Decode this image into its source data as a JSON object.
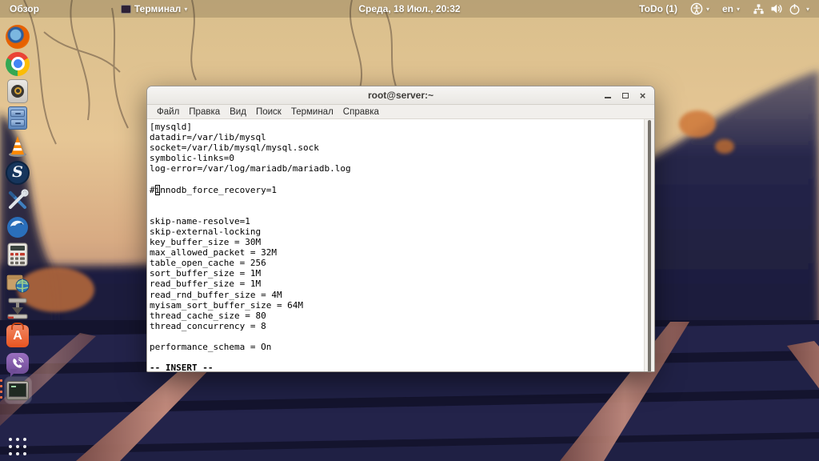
{
  "colors": {
    "accent_orange": "#e95420",
    "topbar_bg_tint": "rgba(62,50,30,0.20)",
    "terminal_bg": "#ffffff",
    "terminal_fg": "#000000",
    "rail_rust": "#c98f7f",
    "forest_navy": "#1d1d3a"
  },
  "top_bar": {
    "activities": "Обзор",
    "app_menu_label": "Терминал",
    "caret_glyph": "▾",
    "clock": "Среда, 18 Июл., 20:32",
    "todo": "ToDo (1)",
    "keyboard_layout": "en",
    "icons": [
      "terminal-mini-icon",
      "accessibility-icon",
      "wired-network-icon",
      "volume-icon",
      "power-icon"
    ]
  },
  "launcher": {
    "items": [
      {
        "name": "firefox"
      },
      {
        "name": "chromium"
      },
      {
        "name": "speaker-media"
      },
      {
        "name": "file-cabinet"
      },
      {
        "name": "vlc"
      },
      {
        "name": "s-app",
        "glyph": "S"
      },
      {
        "name": "tools"
      },
      {
        "name": "thunderbird"
      },
      {
        "name": "calculator"
      },
      {
        "name": "package-globe"
      },
      {
        "name": "archive-press"
      },
      {
        "name": "ubuntu-software",
        "glyph": "A"
      },
      {
        "name": "viber"
      },
      {
        "name": "terminal",
        "active": true,
        "pips": 4
      }
    ],
    "show_apps": "show-applications-grid"
  },
  "window": {
    "title": "root@server:~",
    "controls": {
      "close_glyph": "×"
    },
    "menu": [
      "Файл",
      "Правка",
      "Вид",
      "Поиск",
      "Терминал",
      "Справка"
    ],
    "terminal": {
      "lines_before": [
        "[mysqld]",
        "datadir=/var/lib/mysql",
        "socket=/var/lib/mysql/mysql.sock",
        "symbolic-links=0",
        "log-error=/var/log/mariadb/mariadb.log",
        ""
      ],
      "cursor_line": {
        "prefix": "#",
        "cursor_char": "i",
        "suffix": "nnodb_force_recovery=1"
      },
      "lines_after": [
        "",
        "",
        "skip-name-resolve=1",
        "skip-external-locking",
        "key_buffer_size = 30M",
        "max_allowed_packet = 32M",
        "table_open_cache = 256",
        "sort_buffer_size = 1M",
        "read_buffer_size = 1M",
        "read_rnd_buffer_size = 4M",
        "myisam_sort_buffer_size = 64M",
        "thread_cache_size = 80",
        "thread_concurrency = 8",
        "",
        "performance_schema = On",
        ""
      ],
      "status": "-- INSERT --"
    }
  }
}
